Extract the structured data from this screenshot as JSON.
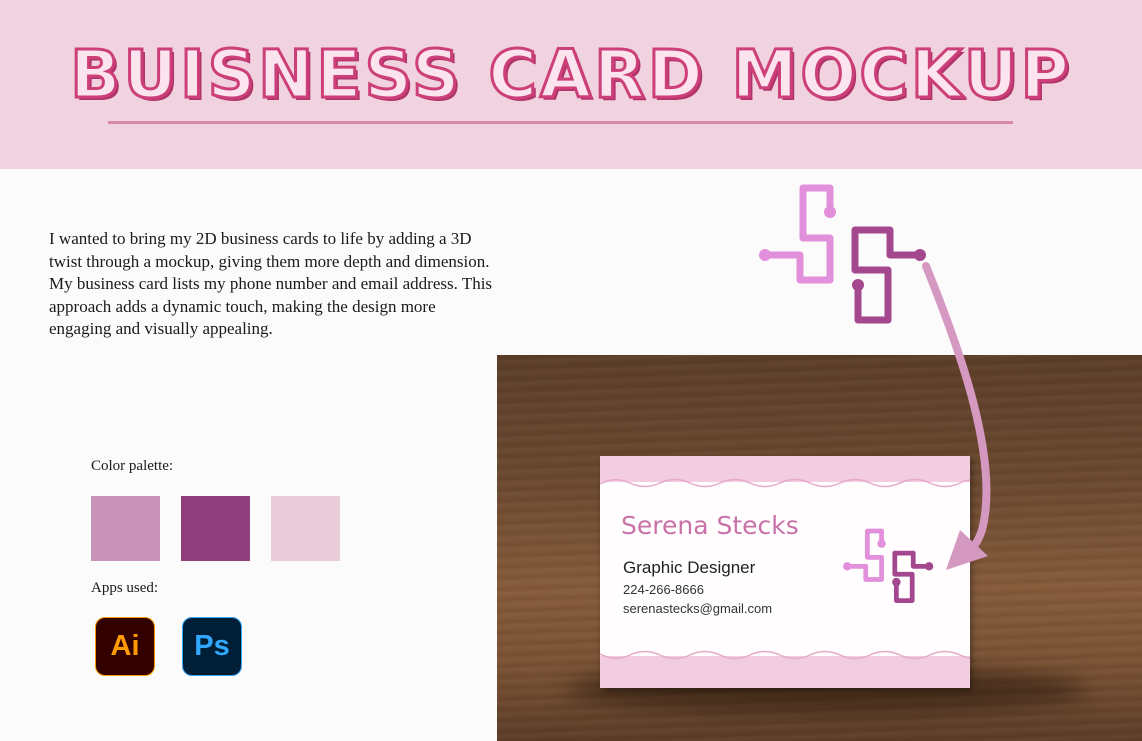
{
  "title": "BUISNESS CARD MOCKUP",
  "description": "I wanted to bring my 2D business cards to life by adding a 3D twist through a mockup, giving them more depth and dimension. My business card lists my phone number and email address. This approach adds a dynamic touch, making the design more engaging and visually appealing.",
  "palette": {
    "label": "Color palette:",
    "colors": [
      "#c895b8",
      "#8f3f7b",
      "#e8cdd8"
    ]
  },
  "apps": {
    "label": "Apps used:",
    "items": [
      {
        "name": "Ai",
        "icon": "adobe-illustrator-icon"
      },
      {
        "name": "Ps",
        "icon": "adobe-photoshop-icon"
      }
    ]
  },
  "card": {
    "name": "Serena Stecks",
    "role": "Graphic Designer",
    "phone": "224-266-8666",
    "email": "serenastecks@gmail.com"
  },
  "logo": {
    "light_color": "#e28fdc",
    "dark_color": "#a3478e"
  },
  "arrow_color": "#d598c0"
}
